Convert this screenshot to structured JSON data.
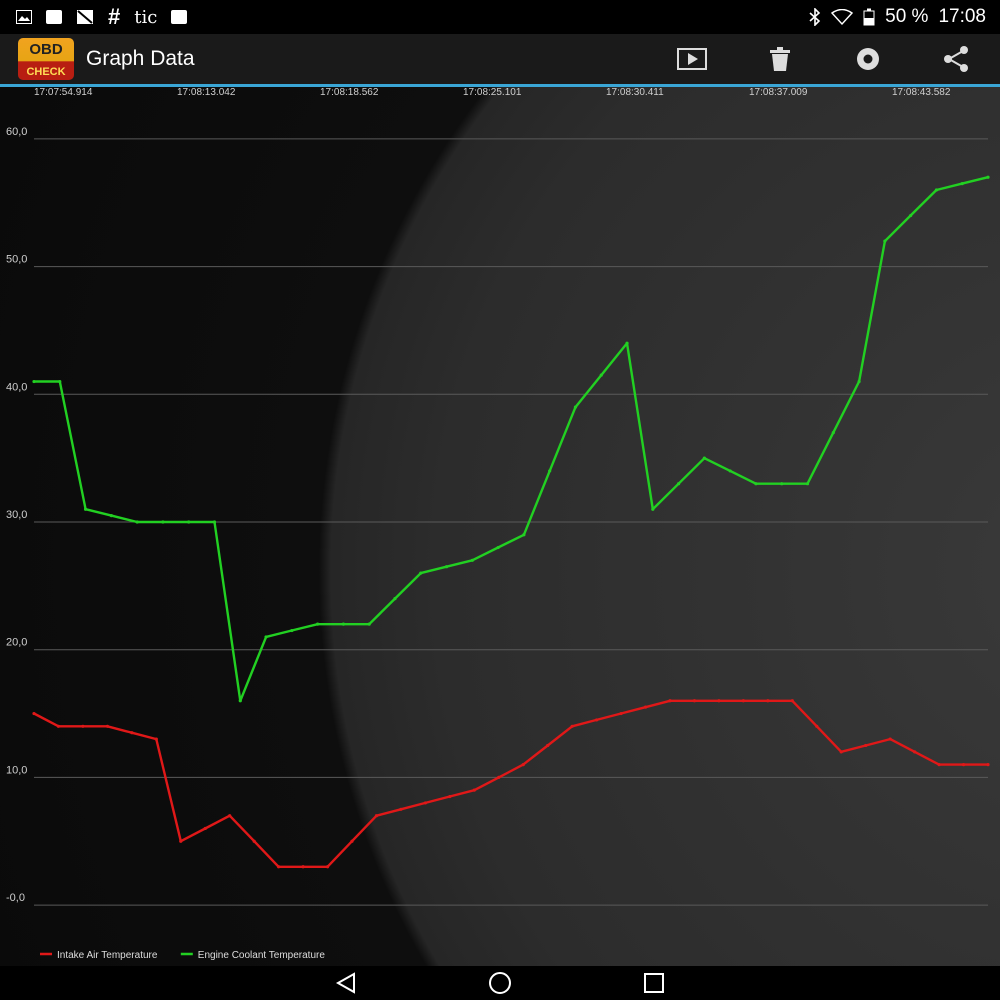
{
  "status_bar": {
    "left_text": "tic",
    "battery": "50 %",
    "time": "17:08"
  },
  "app_bar": {
    "logo_top": "OBD",
    "logo_bottom": "CHECK",
    "title": "Graph Data",
    "actions": [
      "play-icon",
      "trash-icon",
      "settings-icon",
      "share-icon"
    ]
  },
  "chart_data": {
    "type": "line",
    "title": "",
    "xlabel": "",
    "ylabel": "",
    "x_ticks": [
      "17:07:54.914",
      "17:08:13.042",
      "17:08:18.562",
      "17:08:25.101",
      "17:08:30.411",
      "17:08:37.009",
      "17:08:43.582"
    ],
    "y_ticks": [
      "-0,0",
      "10,0",
      "20,0",
      "30,0",
      "40,0",
      "50,0",
      "60,0"
    ],
    "ylim": [
      -2.5,
      62.5
    ],
    "grid": true,
    "legend_position": "bottom-left",
    "point_count": 32,
    "series": [
      {
        "name": "Intake Air Temperature",
        "color": "#e01818",
        "values": [
          15,
          14,
          14,
          14,
          13.5,
          13,
          5,
          6,
          7,
          5,
          3,
          3,
          3,
          5,
          7,
          7.5,
          8,
          8.5,
          9,
          10,
          11,
          12.5,
          14,
          14.5,
          15,
          15.5,
          16,
          16,
          16,
          16,
          16,
          16,
          14,
          12,
          12.5,
          13,
          12,
          11,
          11,
          11
        ]
      },
      {
        "name": "Engine Coolant Temperature",
        "color": "#22d022",
        "values": [
          41,
          41,
          31,
          30.5,
          30,
          30,
          30,
          30,
          16,
          21,
          21.5,
          22,
          22,
          22,
          24,
          26,
          26.5,
          27,
          28,
          29,
          34,
          39,
          41.5,
          44,
          31,
          33,
          35,
          34,
          33,
          33,
          33,
          37,
          41,
          52,
          54,
          56,
          56.5,
          57
        ]
      }
    ]
  }
}
